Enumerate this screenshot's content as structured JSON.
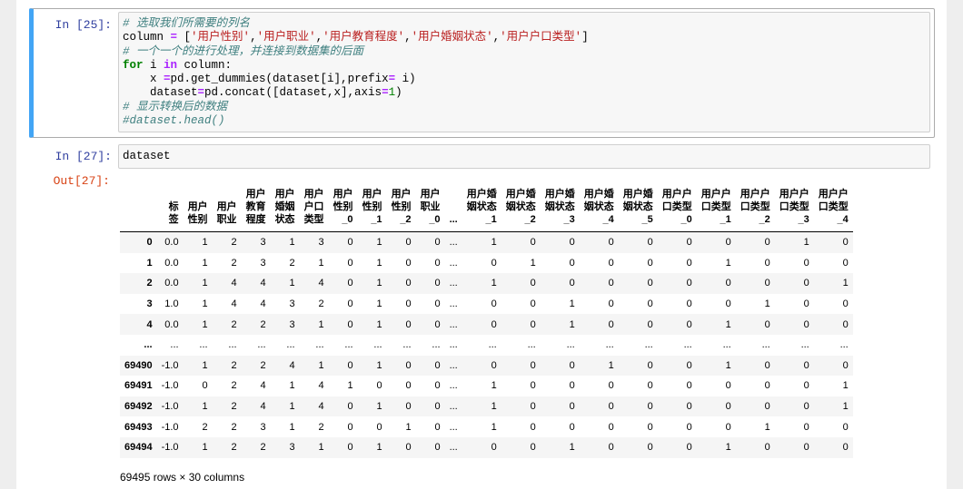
{
  "cells": [
    {
      "prompt": "In  [25]:",
      "code_lines": [
        [
          {
            "t": "# 选取我们所需要的列名",
            "c": "cm"
          }
        ],
        [
          {
            "t": "column ",
            "c": ""
          },
          {
            "t": "=",
            "c": "op"
          },
          {
            "t": " [",
            "c": ""
          },
          {
            "t": "'用户性别'",
            "c": "str"
          },
          {
            "t": ",",
            "c": ""
          },
          {
            "t": "'用户职业'",
            "c": "str"
          },
          {
            "t": ",",
            "c": ""
          },
          {
            "t": "'用户教育程度'",
            "c": "str"
          },
          {
            "t": ",",
            "c": ""
          },
          {
            "t": "'用户婚姻状态'",
            "c": "str"
          },
          {
            "t": ",",
            "c": ""
          },
          {
            "t": "'用户户口类型'",
            "c": "str"
          },
          {
            "t": "]",
            "c": ""
          }
        ],
        [
          {
            "t": "# 一个一个的进行处理，并连接到数据集的后面",
            "c": "cm"
          }
        ],
        [
          {
            "t": "for",
            "c": "kw"
          },
          {
            "t": " i ",
            "c": ""
          },
          {
            "t": "in",
            "c": "op"
          },
          {
            "t": " column:",
            "c": ""
          }
        ],
        [
          {
            "t": "    x ",
            "c": ""
          },
          {
            "t": "=",
            "c": "op"
          },
          {
            "t": "pd.get_dummies(dataset[i],prefix",
            "c": ""
          },
          {
            "t": "=",
            "c": "op"
          },
          {
            "t": " i)",
            "c": ""
          }
        ],
        [
          {
            "t": "    dataset",
            "c": ""
          },
          {
            "t": "=",
            "c": "op"
          },
          {
            "t": "pd.concat([dataset,x],axis",
            "c": ""
          },
          {
            "t": "=",
            "c": "op"
          },
          {
            "t": "1",
            "c": "num"
          },
          {
            "t": ")",
            "c": ""
          }
        ],
        [
          {
            "t": "# 显示转换后的数据",
            "c": "cm"
          }
        ],
        [
          {
            "t": "#dataset.head()",
            "c": "cm"
          }
        ]
      ]
    },
    {
      "prompt": "In  [27]:",
      "code": "dataset",
      "out_prompt": "Out[27]:"
    }
  ],
  "dataframe": {
    "columns": [
      [
        "标",
        "签"
      ],
      [
        "用户",
        "性别"
      ],
      [
        "用户",
        "职业"
      ],
      [
        "用户",
        "教育",
        "程度"
      ],
      [
        "用户",
        "婚姻",
        "状态"
      ],
      [
        "用户",
        "户口",
        "类型"
      ],
      [
        "用户",
        "性别",
        "_0"
      ],
      [
        "用户",
        "性别",
        "_1"
      ],
      [
        "用户",
        "性别",
        "_2"
      ],
      [
        "用户",
        "职业",
        "_0"
      ],
      [
        "..."
      ],
      [
        "用户婚",
        "姻状态",
        "_1"
      ],
      [
        "用户婚",
        "姻状态",
        "_2"
      ],
      [
        "用户婚",
        "姻状态",
        "_3"
      ],
      [
        "用户婚",
        "姻状态",
        "_4"
      ],
      [
        "用户婚",
        "姻状态",
        "_5"
      ],
      [
        "用户户",
        "口类型",
        "_0"
      ],
      [
        "用户户",
        "口类型",
        "_1"
      ],
      [
        "用户户",
        "口类型",
        "_2"
      ],
      [
        "用户户",
        "口类型",
        "_3"
      ],
      [
        "用户户",
        "口类型",
        "_4"
      ]
    ],
    "rows": [
      [
        "0",
        "0.0",
        "1",
        "2",
        "3",
        "1",
        "3",
        "0",
        "1",
        "0",
        "0",
        "...",
        "1",
        "0",
        "0",
        "0",
        "0",
        "0",
        "0",
        "0",
        "1",
        "0"
      ],
      [
        "1",
        "0.0",
        "1",
        "2",
        "3",
        "2",
        "1",
        "0",
        "1",
        "0",
        "0",
        "...",
        "0",
        "1",
        "0",
        "0",
        "0",
        "0",
        "1",
        "0",
        "0",
        "0"
      ],
      [
        "2",
        "0.0",
        "1",
        "4",
        "4",
        "1",
        "4",
        "0",
        "1",
        "0",
        "0",
        "...",
        "1",
        "0",
        "0",
        "0",
        "0",
        "0",
        "0",
        "0",
        "0",
        "1"
      ],
      [
        "3",
        "1.0",
        "1",
        "4",
        "4",
        "3",
        "2",
        "0",
        "1",
        "0",
        "0",
        "...",
        "0",
        "0",
        "1",
        "0",
        "0",
        "0",
        "0",
        "1",
        "0",
        "0"
      ],
      [
        "4",
        "0.0",
        "1",
        "2",
        "2",
        "3",
        "1",
        "0",
        "1",
        "0",
        "0",
        "...",
        "0",
        "0",
        "1",
        "0",
        "0",
        "0",
        "1",
        "0",
        "0",
        "0"
      ],
      [
        "...",
        "...",
        "...",
        "...",
        "...",
        "...",
        "...",
        "...",
        "...",
        "...",
        "...",
        "...",
        "...",
        "...",
        "...",
        "...",
        "...",
        "...",
        "...",
        "...",
        "...",
        "..."
      ],
      [
        "69490",
        "-1.0",
        "1",
        "2",
        "2",
        "4",
        "1",
        "0",
        "1",
        "0",
        "0",
        "...",
        "0",
        "0",
        "0",
        "1",
        "0",
        "0",
        "1",
        "0",
        "0",
        "0"
      ],
      [
        "69491",
        "-1.0",
        "0",
        "2",
        "4",
        "1",
        "4",
        "1",
        "0",
        "0",
        "0",
        "...",
        "1",
        "0",
        "0",
        "0",
        "0",
        "0",
        "0",
        "0",
        "0",
        "1"
      ],
      [
        "69492",
        "-1.0",
        "1",
        "2",
        "4",
        "1",
        "4",
        "0",
        "1",
        "0",
        "0",
        "...",
        "1",
        "0",
        "0",
        "0",
        "0",
        "0",
        "0",
        "0",
        "0",
        "1"
      ],
      [
        "69493",
        "-1.0",
        "2",
        "2",
        "3",
        "1",
        "2",
        "0",
        "0",
        "1",
        "0",
        "...",
        "1",
        "0",
        "0",
        "0",
        "0",
        "0",
        "0",
        "1",
        "0",
        "0"
      ],
      [
        "69494",
        "-1.0",
        "1",
        "2",
        "2",
        "3",
        "1",
        "0",
        "1",
        "0",
        "0",
        "...",
        "0",
        "0",
        "1",
        "0",
        "0",
        "0",
        "1",
        "0",
        "0",
        "0"
      ]
    ],
    "shape_text": "69495 rows × 30 columns"
  }
}
